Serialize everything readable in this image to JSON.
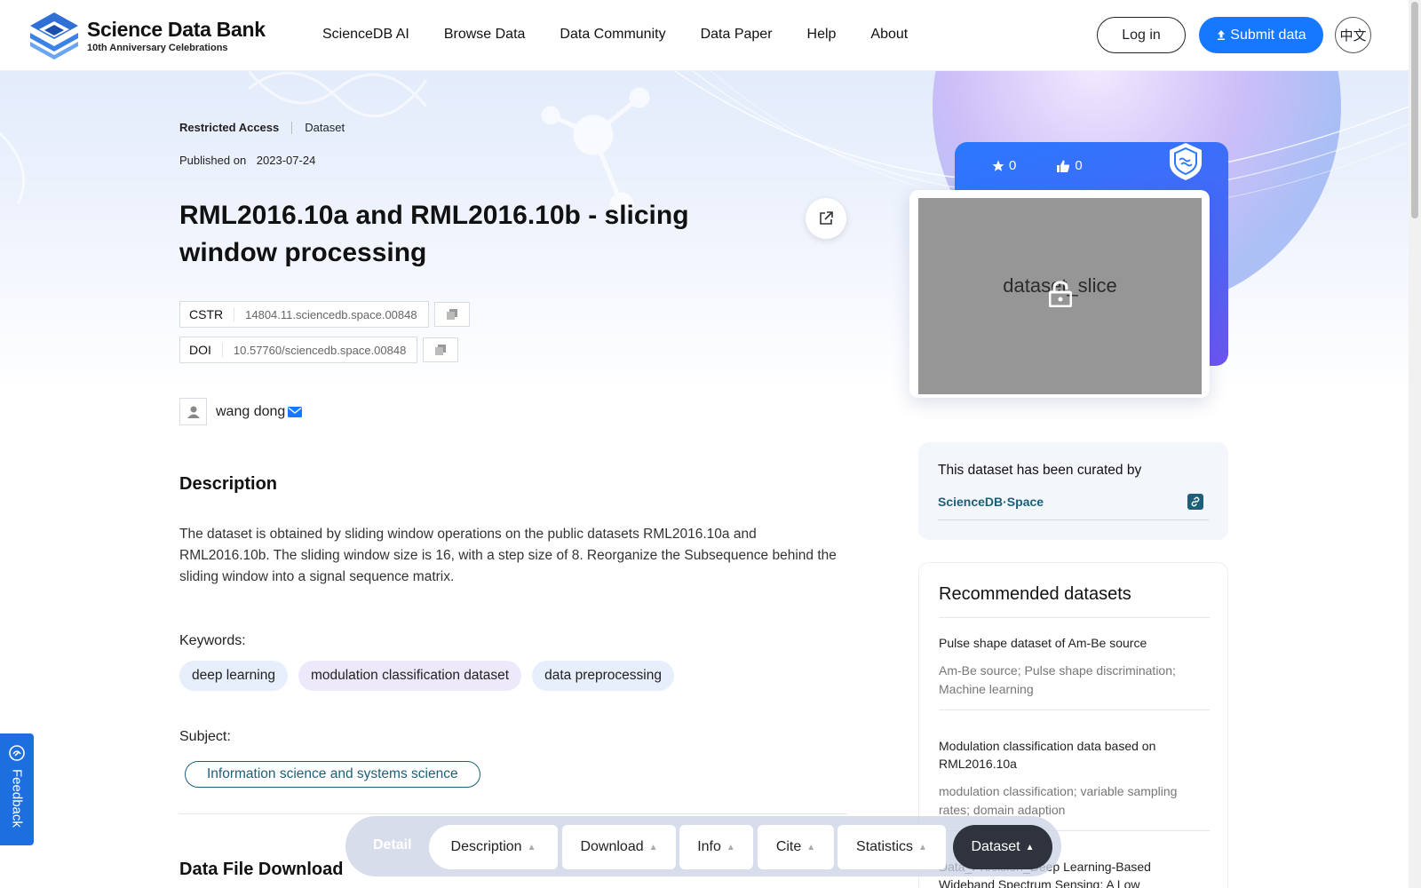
{
  "header": {
    "logo_title": "Science Data Bank",
    "logo_subtitle": "10th Anniversary Celebrations",
    "nav": [
      "ScienceDB AI",
      "Browse Data",
      "Data Community",
      "Data Paper",
      "Help",
      "About"
    ],
    "login_label": "Log in",
    "submit_label": "Submit data",
    "lang_label": "中文"
  },
  "dataset": {
    "access": "Restricted Access",
    "type": "Dataset",
    "published_label": "Published on",
    "published_date": "2023-07-24",
    "title": "RML2016.10a and RML2016.10b - slicing window processing",
    "cstr_label": "CSTR",
    "cstr_value": "14804.11.sciencedb.space.00848",
    "doi_label": "DOI",
    "doi_value": "10.57760/sciencedb.space.00848",
    "author": "wang dong",
    "description_heading": "Description",
    "description": "The dataset is obtained by sliding window operations on the public datasets RML2016.10a and RML2016.10b. The sliding window size is 16, with a step size of 8. Reorganize the Subsequence behind the sliding window into a signal sequence matrix.",
    "keywords_label": "Keywords:",
    "keywords": [
      "deep learning",
      "modulation classification dataset",
      "data preprocessing"
    ],
    "subject_label": "Subject:",
    "subject": "Information science and systems science",
    "data_file_heading": "Data File Download"
  },
  "cover": {
    "stars": "0",
    "likes": "0",
    "image_label": "dataset_slice"
  },
  "curated": {
    "text": "This dataset has been curated by",
    "source": "ScienceDB·Space"
  },
  "recommended": {
    "heading": "Recommended datasets",
    "items": [
      {
        "name": "Pulse shape dataset of Am-Be source",
        "keywords": "Am-Be source; Pulse shape discrimination; Machine learning"
      },
      {
        "name": "Modulation classification data based on RML2016.10a",
        "keywords": "modulation classification; variable sampling rates; domain adaption"
      },
      {
        "name": "Data_Precision_Deep Learning-Based Wideband Spectrum Sensing: A Low",
        "keywords": ""
      }
    ]
  },
  "feedback_label": "Feedback",
  "bottom_nav": {
    "detail": "Detail",
    "tabs": [
      "Description",
      "Download",
      "Info",
      "Cite",
      "Statistics",
      "Dataset"
    ]
  },
  "colors": {
    "primary": "#1677ff",
    "accent_teal": "#1d5f78",
    "feedback": "#1d6fe0"
  }
}
